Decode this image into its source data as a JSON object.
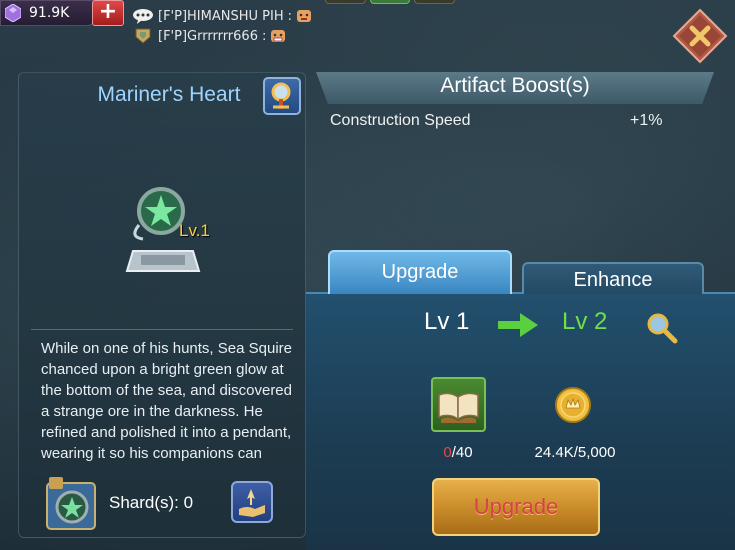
{
  "topbar": {
    "gems": "91.9K",
    "plus_label": "+",
    "chat": [
      {
        "name": "[F'P]HIMANSHU PIH",
        "separator": ":"
      },
      {
        "name": "[F'P]Grrrrrrr666",
        "separator": ":"
      }
    ]
  },
  "artifact": {
    "name": "Mariner's Heart",
    "level_label": "Lv.1",
    "description": "While on one of his hunts, Sea Squire chanced upon a bright green glow at the bottom of the sea, and discovered a strange ore in the darkness. He refined and polished it into a pendant, wearing it so his companions can",
    "shards_label": "Shard(s): 0"
  },
  "boost": {
    "title": "Artifact Boost(s)",
    "rows": [
      {
        "stat": "Construction Speed",
        "value": "+1%"
      }
    ]
  },
  "tabs": {
    "upgrade": "Upgrade",
    "enhance": "Enhance"
  },
  "upgrade": {
    "from_level": "Lv 1",
    "to_level": "Lv 2",
    "book_have": "0",
    "book_need": "/40",
    "coin_requirement": "24.4K/5,000",
    "button_label": "Upgrade"
  }
}
